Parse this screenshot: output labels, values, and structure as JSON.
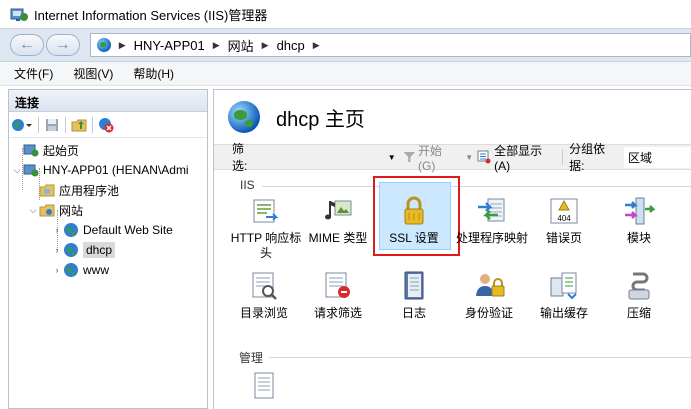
{
  "window": {
    "title": "Internet Information Services (IIS)管理器"
  },
  "address": {
    "crumbs": [
      "HNY-APP01",
      "网站",
      "dhcp"
    ]
  },
  "menu": {
    "file": "文件(F)",
    "view": "视图(V)",
    "help": "帮助(H)"
  },
  "left_panel": {
    "header": "连接",
    "tree": {
      "start_page": "起始页",
      "server": "HNY-APP01 (HENAN\\Admi",
      "app_pools": "应用程序池",
      "sites": "网站",
      "site_default": "Default Web Site",
      "site_dhcp": "dhcp",
      "site_www": "www"
    }
  },
  "main": {
    "title": "dhcp 主页",
    "filter": {
      "label": "筛选:",
      "start": "开始(G)",
      "show_all": "全部显示(A)",
      "group_by_label": "分组依据:",
      "group_by_value": "区域"
    },
    "groups": {
      "iis": "IIS",
      "management": "管理"
    },
    "features_row1": {
      "http_headers": "HTTP 响应标头",
      "mime": "MIME 类型",
      "ssl": "SSL 设置",
      "handler": "处理程序映射",
      "errors": "错误页",
      "modules": "模块"
    },
    "features_row2": {
      "dir_browse": "目录浏览",
      "req_filter": "请求筛选",
      "logging": "日志",
      "auth": "身份验证",
      "output_cache": "输出缓存",
      "compression": "压缩"
    },
    "error_icon_text": "404"
  },
  "colors": {
    "highlight_border": "#e01b1b",
    "selection_fill": "#cce8ff"
  }
}
